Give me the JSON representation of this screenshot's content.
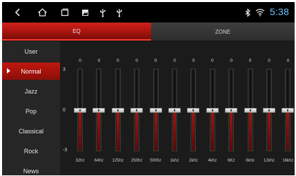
{
  "status_bar": {
    "icons": [
      "back-icon",
      "home-icon",
      "recent-apps-icon",
      "image-icon",
      "usb-icon",
      "usb-icon",
      "bluetooth-icon",
      "wifi-icon"
    ],
    "time": "5:38",
    "time_color": "#6fc6ff"
  },
  "tabs": [
    {
      "label": "EQ",
      "active": true
    },
    {
      "label": "ZONE",
      "active": false
    }
  ],
  "sidebar": {
    "items": [
      {
        "label": "User",
        "active": false
      },
      {
        "label": "Normal",
        "active": true
      },
      {
        "label": "Jazz",
        "active": false
      },
      {
        "label": "Pop",
        "active": false
      },
      {
        "label": "Classical",
        "active": false
      },
      {
        "label": "Rock",
        "active": false
      },
      {
        "label": "News",
        "active": false
      }
    ]
  },
  "equalizer": {
    "scale": {
      "max": "3",
      "mid": "0",
      "min": "-3"
    },
    "range": [
      -3,
      3
    ],
    "bands": [
      {
        "label": "32hz",
        "value": "0",
        "level": 0
      },
      {
        "label": "64hz",
        "value": "0",
        "level": 0
      },
      {
        "label": "125hz",
        "value": "0",
        "level": 0
      },
      {
        "label": "250hz",
        "value": "0",
        "level": 0
      },
      {
        "label": "500hz",
        "value": "0",
        "level": 0
      },
      {
        "label": "1khz",
        "value": "0",
        "level": 0
      },
      {
        "label": "2khz",
        "value": "0",
        "level": 0
      },
      {
        "label": "4khz",
        "value": "0",
        "level": 0
      },
      {
        "label": "6Kz",
        "value": "0",
        "level": 0
      },
      {
        "label": "8khz",
        "value": "0",
        "level": 0
      },
      {
        "label": "12khz",
        "value": "0",
        "level": 0
      },
      {
        "label": "16khz",
        "value": "0",
        "level": 0
      }
    ]
  },
  "colors": {
    "accent_red": "#c0180f",
    "background": "#141414",
    "sidebar_bg": "#262626"
  }
}
